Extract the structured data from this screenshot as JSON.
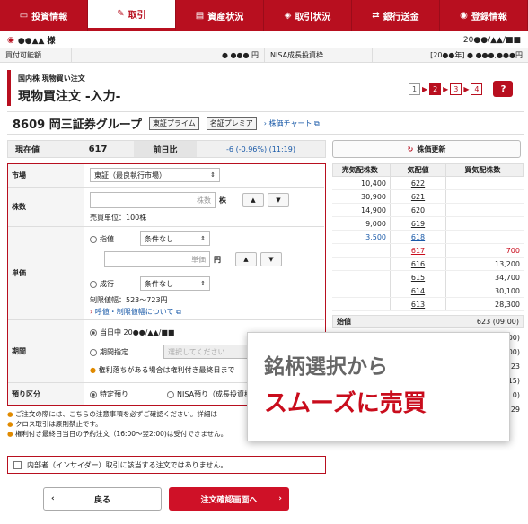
{
  "nav": [
    {
      "label": "投資情報",
      "icon": "monitor-icon"
    },
    {
      "label": "取引",
      "icon": "pen-icon"
    },
    {
      "label": "資産状況",
      "icon": "document-icon"
    },
    {
      "label": "取引状況",
      "icon": "tag-icon"
    },
    {
      "label": "銀行送金",
      "icon": "transfer-icon"
    },
    {
      "label": "登録情報",
      "icon": "person-icon"
    }
  ],
  "account": {
    "name": "●●▲▲ 様",
    "date": "20●●/▲▲/■■"
  },
  "balance": {
    "buying_power_label": "買付可能額",
    "buying_power": "●.●●● 円",
    "nisa_label": "NISA成長投資枠",
    "nisa_value": "[20●●年] ●.●●●,●●●円"
  },
  "page": {
    "subtitle": "国内株 現物買い注文",
    "title": "現物買注文 -入力-",
    "steps": [
      "1",
      "2",
      "3",
      "4"
    ],
    "help": "?"
  },
  "stock": {
    "name": "8609 岡三証券グループ",
    "tag1": "東証プライム",
    "tag2": "名証プレミア",
    "chart_link": "株価チャート"
  },
  "quote": {
    "price_label": "現在値",
    "price": "617",
    "prev_label": "前日比",
    "change": "-6 (-0.96%) (11:19)",
    "refresh": "株価更新"
  },
  "form": {
    "market_label": "市場",
    "market": "東証（最良執行市場）",
    "qty_label": "株数",
    "qty_placeholder": "株数",
    "qty_unit": "株",
    "unit_text": "売買単位：100株",
    "price_label": "単価",
    "limit": "指値",
    "cond1": "条件なし",
    "price_placeholder": "単価",
    "yen": "円",
    "market_order": "成行",
    "cond2": "条件なし",
    "limit_range": "制限値幅：523〜723円",
    "tick_link": "呼値・制限値幅について",
    "period_label": "期間",
    "today": "当日中 20●●/▲▲/■■",
    "period_spec": "期間指定",
    "period_placeholder": "選択してください",
    "period_note": "権利落ちがある場合は権利付き最終日まで",
    "deposit_label": "預り区分",
    "specific": "特定預り",
    "nisa": "NISA預り（成長投資枠）"
  },
  "book": {
    "headers": [
      "売気配株数",
      "気配値",
      "買気配株数"
    ],
    "rows": [
      [
        "10,400",
        "622",
        ""
      ],
      [
        "30,900",
        "621",
        ""
      ],
      [
        "14,900",
        "620",
        ""
      ],
      [
        "9,000",
        "619",
        ""
      ],
      [
        "3,500",
        "618",
        ""
      ],
      [
        "",
        "617",
        "700"
      ],
      [
        "",
        "616",
        "13,200"
      ],
      [
        "",
        "615",
        "34,700"
      ],
      [
        "",
        "614",
        "30,100"
      ],
      [
        "",
        "613",
        "28,300"
      ]
    ],
    "open_label": "始値",
    "open_value": "623 (09:00)",
    "right_snippets": [
      "00)",
      "00)",
      "23",
      "15)",
      "0)",
      "29"
    ]
  },
  "notes": [
    "ご注文の際には、こちらの注意事項を必ずご確認ください。詳細は",
    "クロス取引は原則禁止です。",
    "権利付き最終日当日の予約注文（16:00〜翌2:00)は受付できません。"
  ],
  "insider": "内部者（インサイダー）取引に該当する注文ではありません。",
  "buttons": {
    "back": "戻る",
    "confirm": "注文確認画面へ"
  },
  "overlay": {
    "line1": "銘柄選択から",
    "line2": "スムーズに売買"
  },
  "colors": {
    "brand": "#b80f1f",
    "link": "#1a5aa8",
    "down": "#1a5aa8",
    "up": "#c90c1c"
  }
}
